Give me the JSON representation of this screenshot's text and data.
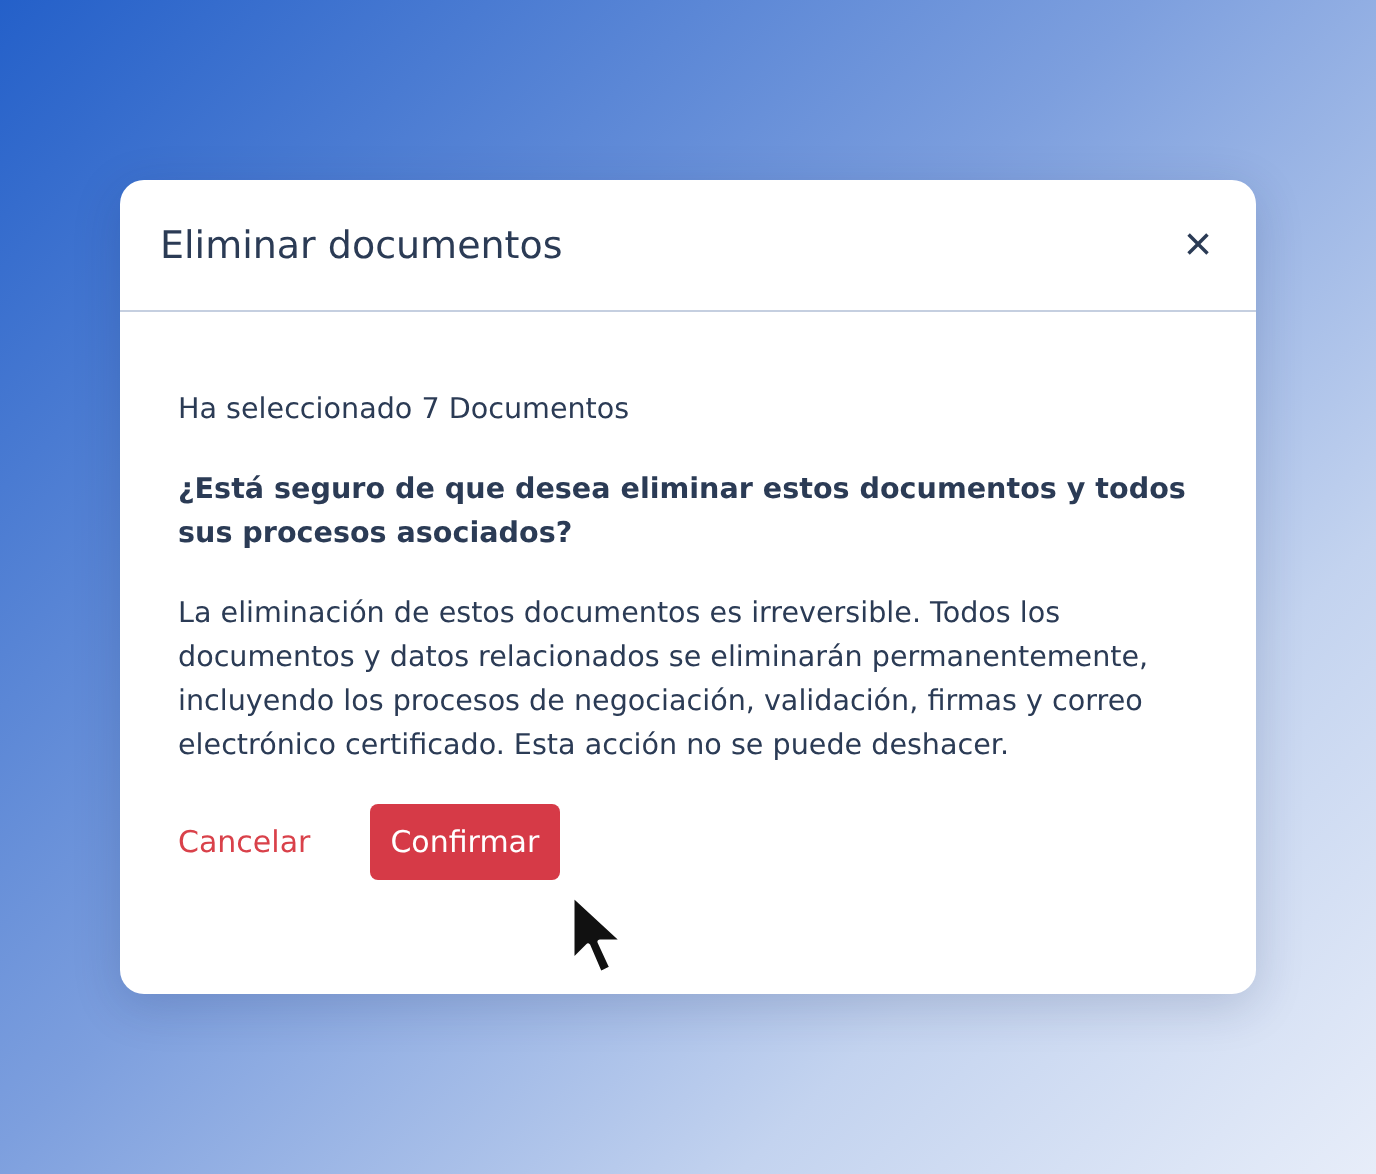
{
  "dialog": {
    "title": "Eliminar documentos",
    "close": "×",
    "summary": "Ha seleccionado 7 Documentos",
    "question": "¿Está seguro de que desea eliminar estos documentos y todos sus procesos asociados?",
    "warning": "La eliminación de estos documentos es irreversible. Todos los documentos y datos relacionados se eliminarán permanentemente, incluyendo los procesos de negociación, validación, firmas y correo electrónico certificado. Esta acción no se puede deshacer.",
    "buttons": [
      {
        "label": "Cancelar",
        "kind": "link"
      },
      {
        "label": "Confirmar",
        "kind": "primary"
      }
    ]
  }
}
